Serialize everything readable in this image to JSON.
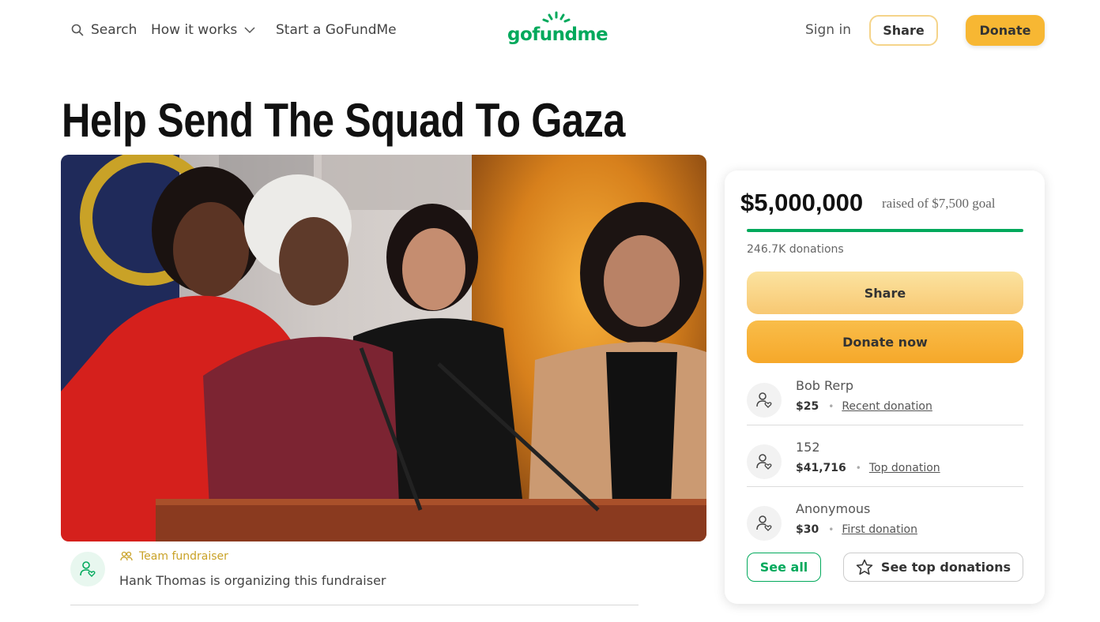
{
  "nav": {
    "search_label": "Search",
    "how_it_works_label": "How it works",
    "start_label": "Start a GoFundMe",
    "logo_text": "gofundme",
    "sign_in_label": "Sign in",
    "share_label": "Share",
    "donate_label": "Donate"
  },
  "campaign": {
    "title": "Help Send The Squad To Gaza",
    "photo_description_icon": "campaign-photo"
  },
  "organizer": {
    "tag": "Team fundraiser",
    "text": "Hank Thomas is organizing this fundraiser"
  },
  "card": {
    "amount_raised": "$5,000,000",
    "goal_text": "raised of $7,500 goal",
    "progress_fraction": 1.0,
    "donations_count": "246.7K donations",
    "share_label": "Share",
    "donate_now_label": "Donate now",
    "donors": [
      {
        "name": "Bob Rerp",
        "amount": "$25",
        "type": "Recent donation"
      },
      {
        "name": "152",
        "amount": "$41,716",
        "type": "Top donation"
      },
      {
        "name": "Anonymous",
        "amount": "$30",
        "type": "First donation"
      }
    ],
    "see_all_label": "See all",
    "see_top_label": "See top donations"
  },
  "colors": {
    "brand_green": "#02a95c",
    "donate_yellow": "#f7b733"
  }
}
